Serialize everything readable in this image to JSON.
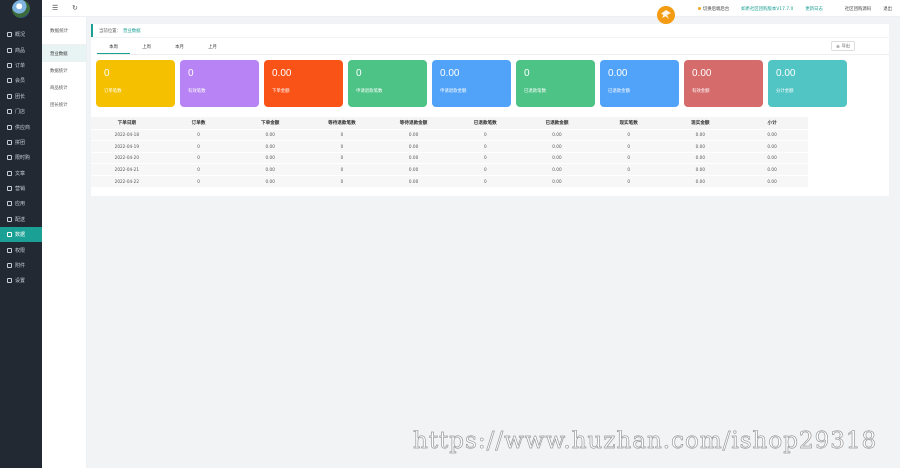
{
  "sidebar": {
    "items": [
      {
        "label": "概况",
        "icon": "home-icon"
      },
      {
        "label": "商品",
        "icon": "goods-icon"
      },
      {
        "label": "订单",
        "icon": "order-icon"
      },
      {
        "label": "会员",
        "icon": "member-icon"
      },
      {
        "label": "团长",
        "icon": "leader-icon"
      },
      {
        "label": "门店",
        "icon": "store-icon"
      },
      {
        "label": "供应商",
        "icon": "supplier-icon"
      },
      {
        "label": "拼团",
        "icon": "group-icon"
      },
      {
        "label": "限时购",
        "icon": "flash-icon"
      },
      {
        "label": "文章",
        "icon": "article-icon"
      },
      {
        "label": "营销",
        "icon": "marketing-icon"
      },
      {
        "label": "应用",
        "icon": "apps-icon"
      },
      {
        "label": "配送",
        "icon": "delivery-icon"
      },
      {
        "label": "数据",
        "icon": "data-icon"
      },
      {
        "label": "权限",
        "icon": "permission-icon"
      },
      {
        "label": "附件",
        "icon": "attachment-icon"
      },
      {
        "label": "设置",
        "icon": "settings-icon"
      }
    ],
    "active_index": 13
  },
  "topbar": {
    "manage": "切换后端后台",
    "version": "如希社区团购版本V17.7.0",
    "update_log": "更新日志",
    "community": "社区团购源码",
    "logout": "退出"
  },
  "submenu": {
    "title": "数据统计",
    "items": [
      "营业数据",
      "数据统计",
      "商品统计",
      "团长统计"
    ],
    "active_index": 0
  },
  "breadcrumb": {
    "prefix": "当前位置：",
    "current": "营业数据"
  },
  "tabs": [
    "本周",
    "上周",
    "本月",
    "上月"
  ],
  "active_tab": 0,
  "export_label": "导出",
  "stats": [
    {
      "value": "0",
      "label": "订单笔数",
      "color": "#f5c000"
    },
    {
      "value": "0",
      "label": "有效笔数",
      "color": "#b884f5"
    },
    {
      "value": "0.00",
      "label": "下单金额",
      "color": "#f95318"
    },
    {
      "value": "0",
      "label": "申请退款笔数",
      "color": "#4dc386"
    },
    {
      "value": "0.00",
      "label": "申请退款金额",
      "color": "#51a3f9"
    },
    {
      "value": "0",
      "label": "已退款笔数",
      "color": "#4dc386"
    },
    {
      "value": "0.00",
      "label": "已退款金额",
      "color": "#51a3f9"
    },
    {
      "value": "0.00",
      "label": "有效金额",
      "color": "#d66b6b"
    },
    {
      "value": "0.00",
      "label": "分计金额",
      "color": "#51c4c4"
    }
  ],
  "table": {
    "headers": [
      "下单日期",
      "订单数",
      "下单金额",
      "等待退款笔数",
      "等待退款金额",
      "已退款笔数",
      "已退款金额",
      "现实笔数",
      "现实金额",
      "小计"
    ],
    "rows": [
      [
        "2022-04-18",
        "0",
        "0.00",
        "0",
        "0.00",
        "0",
        "0.00",
        "0",
        "0.00",
        "0.00"
      ],
      [
        "2022-04-19",
        "0",
        "0.00",
        "0",
        "0.00",
        "0",
        "0.00",
        "0",
        "0.00",
        "0.00"
      ],
      [
        "2022-04-20",
        "0",
        "0.00",
        "0",
        "0.00",
        "0",
        "0.00",
        "0",
        "0.00",
        "0.00"
      ],
      [
        "2022-04-21",
        "0",
        "0.00",
        "0",
        "0.00",
        "0",
        "0.00",
        "0",
        "0.00",
        "0.00"
      ],
      [
        "2022-04-22",
        "0",
        "0.00",
        "0",
        "0.00",
        "0",
        "0.00",
        "0",
        "0.00",
        "0.00"
      ]
    ]
  },
  "watermark": "https://www.huzhan.com/ishop29318"
}
